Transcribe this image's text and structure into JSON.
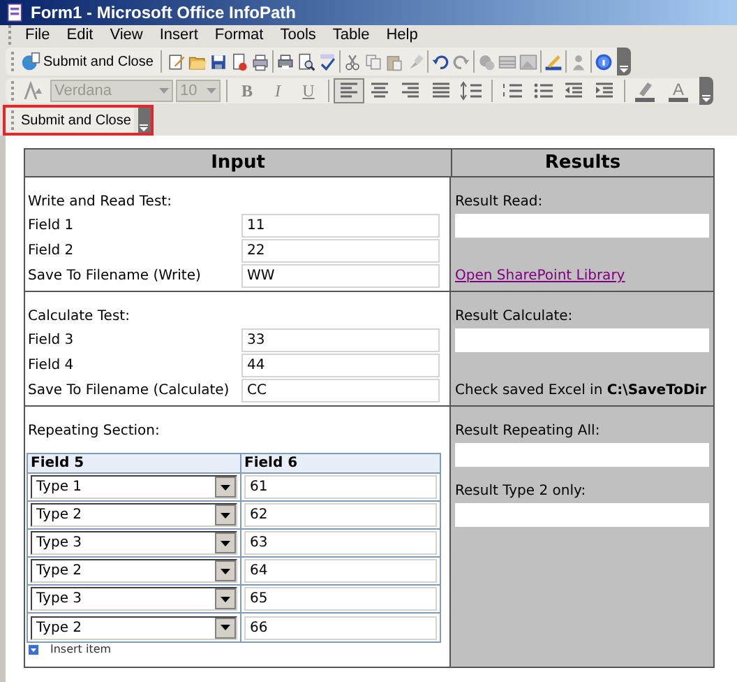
{
  "window": {
    "title": "Form1 - Microsoft Office InfoPath"
  },
  "menu": [
    "File",
    "Edit",
    "View",
    "Insert",
    "Format",
    "Tools",
    "Table",
    "Help"
  ],
  "standard_toolbar": {
    "submit_button": "Submit and Close"
  },
  "formatting_toolbar": {
    "disabled": true,
    "font": "Verdana",
    "size": "10",
    "style_buttons": [
      "B",
      "I",
      "U"
    ],
    "alignment": [
      {
        "selected": true
      },
      {
        "selected": false
      },
      {
        "selected": false
      },
      {
        "selected": false
      }
    ],
    "font_color_button": "A"
  },
  "custom_toolbar": {
    "button": "Submit and Close",
    "highlighted": true
  },
  "form": {
    "headers": [
      "Input",
      "Results"
    ],
    "sections": [
      {
        "title": "Write and Read Test:",
        "fields": [
          {
            "label": "Field 1",
            "value": "11"
          },
          {
            "label": "Field 2",
            "value": "22"
          },
          {
            "label": "Save To Filename (Write)",
            "value": "WW"
          }
        ],
        "results": [
          {
            "kind": "field",
            "label": "Result Read:"
          },
          {
            "kind": "link",
            "label": "Open SharePoint Library"
          }
        ]
      },
      {
        "title": "Calculate Test:",
        "fields": [
          {
            "label": "Field 3",
            "value": "33"
          },
          {
            "label": "Field 4",
            "value": "44"
          },
          {
            "label": "Save To Filename (Calculate)",
            "value": "CC"
          }
        ],
        "results": [
          {
            "kind": "field",
            "label": "Result Calculate:"
          },
          {
            "kind": "note",
            "label": "Check saved Excel in **C:\\SaveToDir**"
          }
        ]
      }
    ],
    "repeating": {
      "title": "Repeating Section:",
      "columns": [
        "Field 5",
        "Field 6"
      ],
      "rows": [
        {
          "type": "Type 1",
          "value": "61"
        },
        {
          "type": "Type 2",
          "value": "62"
        },
        {
          "type": "Type 3",
          "value": "63"
        },
        {
          "type": "Type 2",
          "value": "64"
        },
        {
          "type": "Type 3",
          "value": "65"
        },
        {
          "type": "Type 2",
          "value": "66"
        }
      ],
      "insert_label": "Insert item",
      "results": [
        {
          "kind": "field",
          "label": "Result Repeating All:"
        },
        {
          "kind": "field",
          "label": "Result Type 2 only:"
        }
      ]
    }
  }
}
